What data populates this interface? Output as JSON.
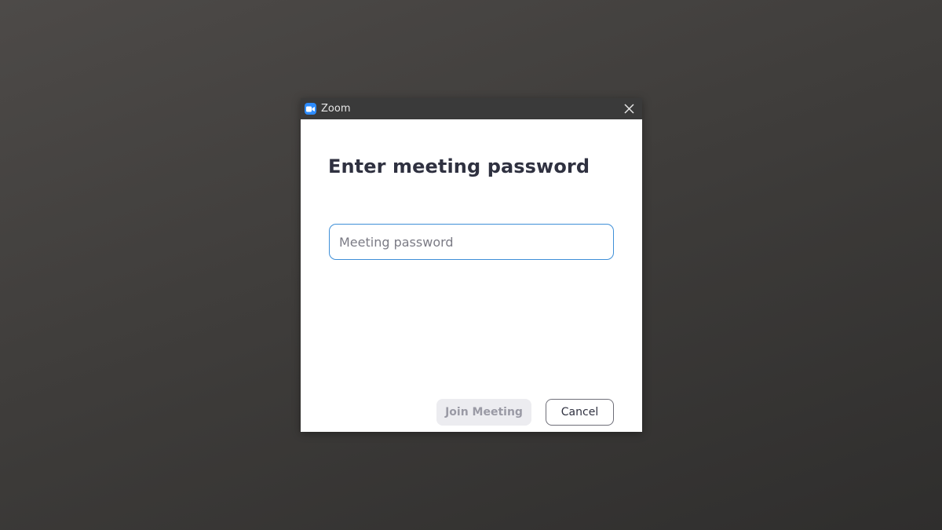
{
  "window": {
    "title": "Zoom",
    "icon": "zoom-camera-icon",
    "close_icon": "close-icon"
  },
  "dialog": {
    "heading": "Enter meeting password",
    "password_input": {
      "value": "",
      "placeholder": "Meeting password"
    },
    "buttons": {
      "join_label": "Join Meeting",
      "cancel_label": "Cancel"
    }
  },
  "colors": {
    "accent": "#2d8cff",
    "input_border": "#3e8fd8",
    "titlebar": "#3a3a3a",
    "heading": "#2f3140",
    "disabled_button_bg": "#ececf0",
    "disabled_button_text": "#9a9aa5"
  }
}
